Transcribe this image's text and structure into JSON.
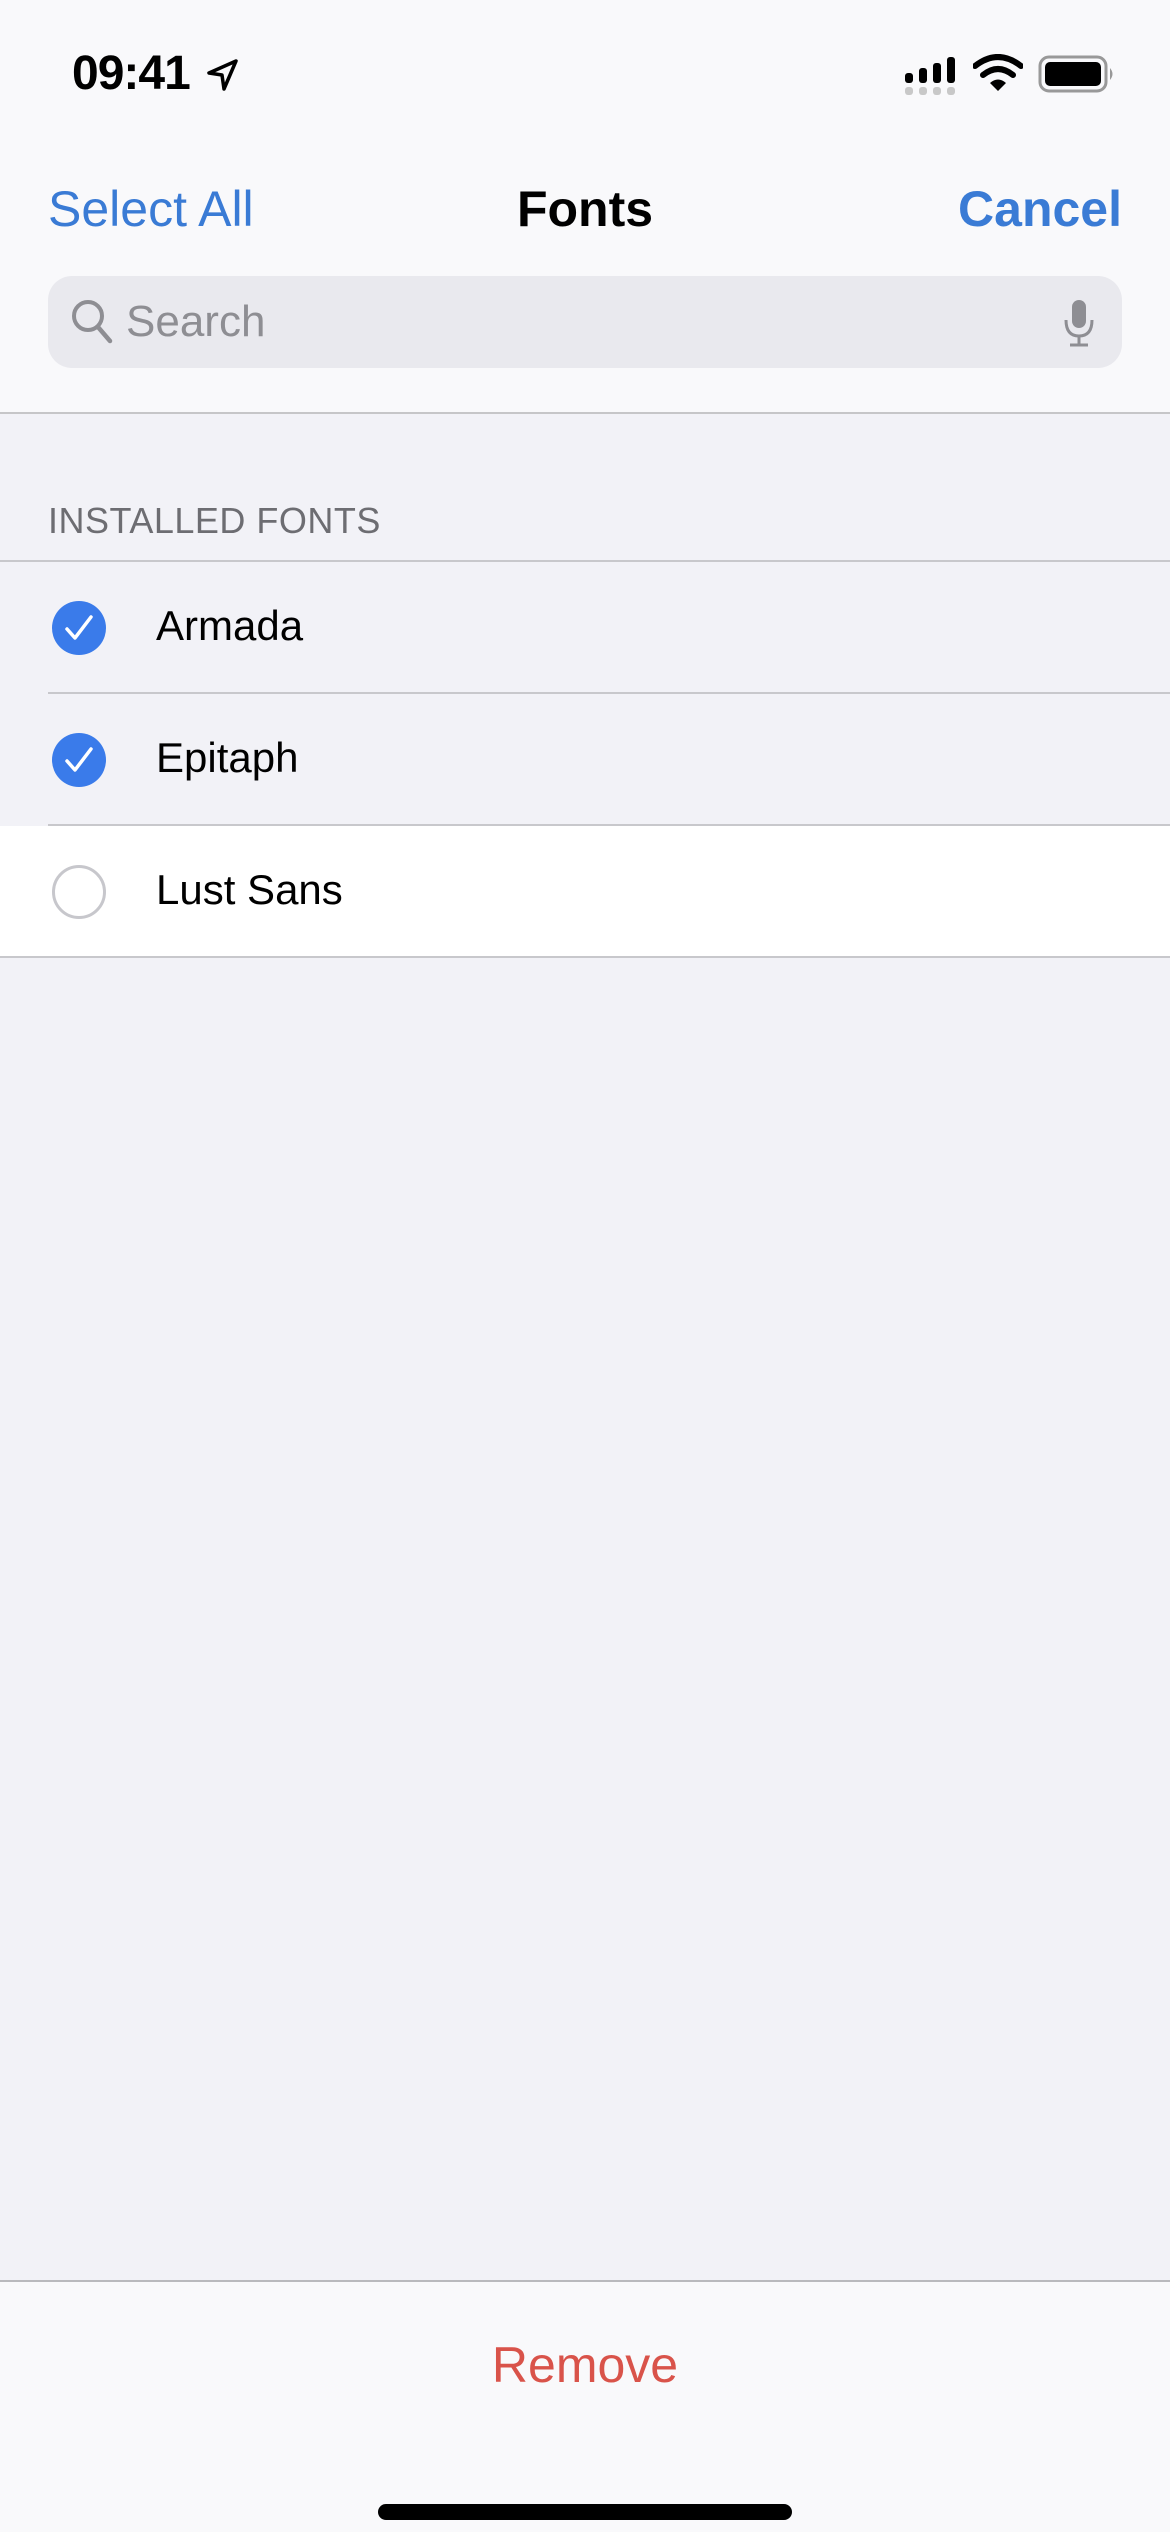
{
  "status_bar": {
    "time": "09:41",
    "icons": [
      "location-arrow-icon",
      "cellular-signal-icon",
      "wifi-icon",
      "battery-icon"
    ]
  },
  "nav": {
    "left_label": "Select All",
    "title": "Fonts",
    "right_label": "Cancel"
  },
  "search": {
    "placeholder": "Search",
    "value": "",
    "icons": [
      "search-icon",
      "microphone-icon"
    ]
  },
  "section": {
    "header": "INSTALLED FONTS",
    "items": [
      {
        "label": "Armada",
        "selected": true
      },
      {
        "label": "Epitaph",
        "selected": true
      },
      {
        "label": "Lust Sans",
        "selected": false
      }
    ]
  },
  "toolbar": {
    "remove_label": "Remove"
  },
  "colors": {
    "accent": "#3a7bd5",
    "check_fill": "#3a7bea",
    "destructive": "#d9534a",
    "background": "#f2f2f7"
  }
}
